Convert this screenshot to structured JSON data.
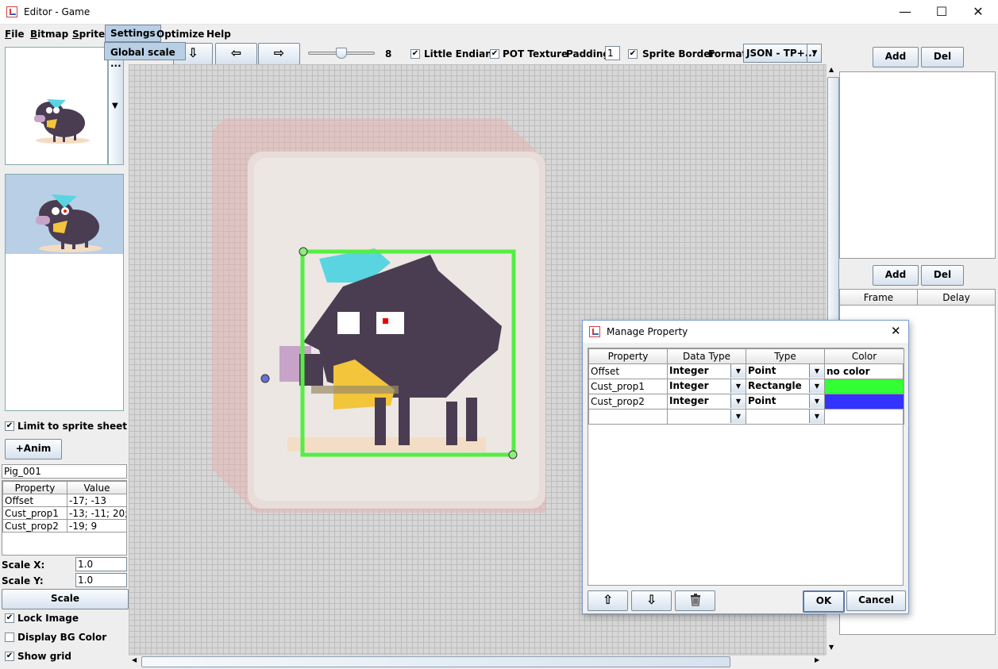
{
  "window": {
    "title": "Editor - Game",
    "minimize": "—",
    "maximize": "☐",
    "close": "✕"
  },
  "menubar": {
    "items": [
      {
        "label": "File",
        "mnemonic": "F",
        "rest": "ile"
      },
      {
        "label": "Bitmap",
        "mnemonic": "B",
        "rest": "itmap"
      },
      {
        "label": "Sprite",
        "mnemonic": "S",
        "rest": "prite"
      },
      {
        "label": "Settings"
      },
      {
        "label": "Optimize"
      },
      {
        "label": "Help"
      }
    ],
    "open_dropdown": {
      "item": "Global scale ..."
    }
  },
  "toolbar": {
    "zoom_value": "8",
    "zoom_fraction": 0.5,
    "little_endian": "Little Endian",
    "pot_texture": "POT Texture",
    "padding_label": "Padding:",
    "padding_value": "1",
    "sprite_border": "Sprite Border",
    "format_label": "Format:",
    "format_value": "JSON - TP+..."
  },
  "left": {
    "limit_to_sprite_sheet": "Limit to sprite sheet",
    "anim_button": "+Anim",
    "sprite_name": "Pig_001",
    "prop_header": {
      "property": "Property",
      "value": "Value"
    },
    "props": [
      {
        "property": "Offset",
        "value": "-17; -13"
      },
      {
        "property": "Cust_prop1",
        "value": "-13; -11; 20;..."
      },
      {
        "property": "Cust_prop2",
        "value": "-19; 9"
      }
    ],
    "scale_x_label": "Scale X:",
    "scale_x_value": "1.0",
    "scale_y_label": "Scale Y:",
    "scale_y_value": "1.0",
    "scale_button": "Scale",
    "lock_image": "Lock Image",
    "display_bg_color": "Display BG Color",
    "show_grid": "Show grid"
  },
  "right": {
    "add1": "Add",
    "del1": "Del",
    "add2": "Add",
    "del2": "Del",
    "frame_header": "Frame",
    "delay_header": "Delay"
  },
  "dialog": {
    "title": "Manage Property",
    "headers": {
      "property": "Property",
      "data_type": "Data Type",
      "type": "Type",
      "color": "Color"
    },
    "rows": [
      {
        "property": "Offset",
        "data_type": "Integer",
        "type": "Point",
        "color_text": "no color",
        "color": "#ffffff"
      },
      {
        "property": "Cust_prop1",
        "data_type": "Integer",
        "type": "Rectangle",
        "color_text": "",
        "color": "#33ff33"
      },
      {
        "property": "Cust_prop2",
        "data_type": "Integer",
        "type": "Point",
        "color_text": "",
        "color": "#3333ff"
      },
      {
        "property": "",
        "data_type": "",
        "type": "",
        "color_text": "",
        "color": "#ffffff"
      }
    ],
    "ok": "OK",
    "cancel": "Cancel"
  },
  "colors": {
    "selection_highlight": "#b8cfe5",
    "rect_outline": "#55ee44",
    "grid": "#bdbdbd"
  }
}
